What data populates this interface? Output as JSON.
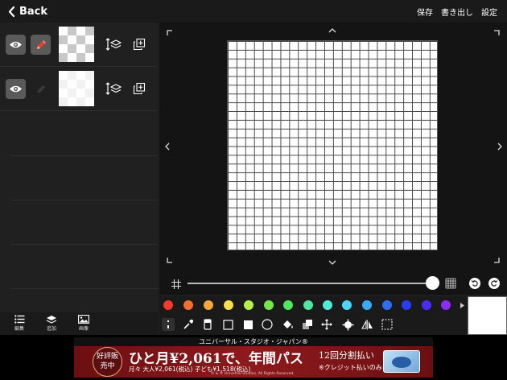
{
  "header": {
    "back_label": "Back",
    "actions": [
      "保存",
      "書き出し",
      "設定"
    ]
  },
  "layers": [
    {
      "visible": true,
      "editing": true,
      "thumb": "checker"
    },
    {
      "visible": true,
      "editing": false,
      "thumb": "white"
    }
  ],
  "bottom_left": {
    "items": [
      {
        "label": "編集",
        "icon": "list-icon"
      },
      {
        "label": "追加",
        "icon": "layers-add-icon"
      },
      {
        "label": "画像",
        "icon": "image-icon"
      }
    ]
  },
  "canvas": {
    "grid_columns": 24,
    "grid_rows": 24
  },
  "zoom": {
    "level": 1.0
  },
  "palette": {
    "colors": [
      "#f23b2a",
      "#f46f2e",
      "#f6a63b",
      "#f7e04a",
      "#b8ee4a",
      "#74e84b",
      "#4de85b",
      "#4de8a0",
      "#4cecd8",
      "#4ad6f6",
      "#3aaaf6",
      "#2e6ff6",
      "#2b3df4",
      "#4a2df2",
      "#8b2df2"
    ],
    "selected_color": "#ffffff"
  },
  "tools": [
    "pen-tool-icon",
    "eyedropper-icon",
    "eraser-icon",
    "rectangle-outline-icon",
    "rectangle-fill-icon",
    "circle-icon",
    "fill-bucket-icon",
    "layers-stack-icon",
    "move-icon",
    "center-target-icon",
    "flip-horizontal-icon",
    "selection-icon"
  ],
  "ad": {
    "top_text": "ユニバーサル・スタジオ・ジャパン®",
    "badge": "好評販売中",
    "headline": "ひと月¥2,061で、年間パス",
    "subline": "月々 大人¥2,061(税込) 子ども¥1,518(税込)",
    "copyright": "© & ® Universal Studios. All Rights Reserved.",
    "right_line1": "12回分割払い",
    "right_line2": "※クレジット払いのみ",
    "close_label": "▷×"
  }
}
